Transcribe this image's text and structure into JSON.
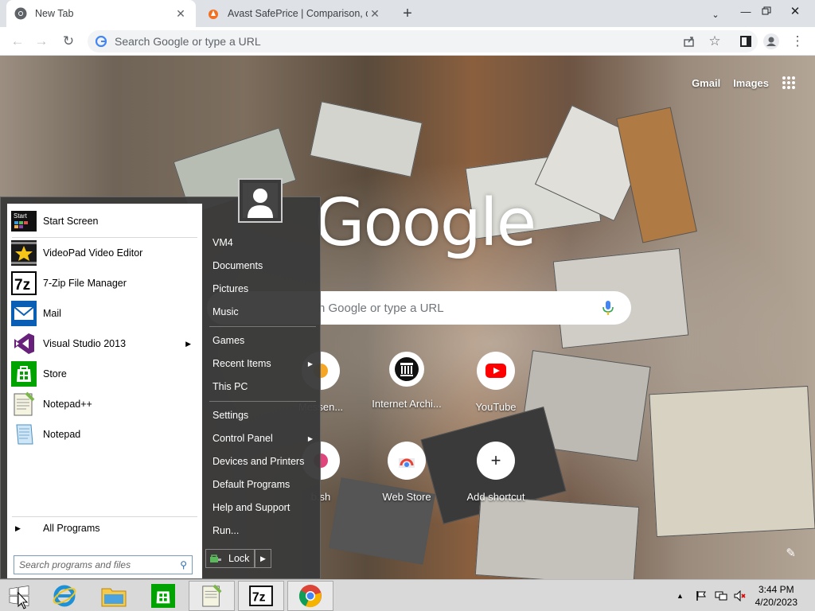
{
  "browser": {
    "tabs": [
      {
        "title": "New Tab",
        "icon": "chrome-icon",
        "active": true
      },
      {
        "title": "Avast SafePrice | Comparison, de",
        "icon": "avast-icon",
        "active": false
      }
    ],
    "new_tab_symbol": "+",
    "omnibox_placeholder": "Search Google or type a URL"
  },
  "ntp": {
    "links": [
      "Gmail",
      "Images"
    ],
    "logo": "Google",
    "search_placeholder": "Search Google or type a URL",
    "search_visible": "h Google or type a URL",
    "shortcuts": [
      {
        "label": "Messen...",
        "icon": "messenger-icon"
      },
      {
        "label": "Internet Archi...",
        "icon": "archive-icon"
      },
      {
        "label": "YouTube",
        "icon": "youtube-icon"
      },
      {
        "label": "b.sh",
        "icon": "site-icon"
      },
      {
        "label": "Web Store",
        "icon": "webstore-icon"
      },
      {
        "label": "Add shortcut",
        "icon": "plus-icon"
      }
    ]
  },
  "start_menu": {
    "programs": [
      {
        "label": "Start Screen",
        "icon": "start-screen-icon",
        "submenu": false
      },
      {
        "label": "VideoPad Video Editor",
        "icon": "videopad-icon",
        "submenu": false
      },
      {
        "label": "7-Zip File Manager",
        "icon": "7zip-icon",
        "submenu": false
      },
      {
        "label": "Mail",
        "icon": "mail-icon",
        "submenu": false
      },
      {
        "label": "Visual Studio 2013",
        "icon": "visual-studio-icon",
        "submenu": true
      },
      {
        "label": "Store",
        "icon": "store-icon",
        "submenu": false
      },
      {
        "label": "Notepad++",
        "icon": "notepadpp-icon",
        "submenu": false
      },
      {
        "label": "Notepad",
        "icon": "notepad-icon",
        "submenu": false
      }
    ],
    "start_icon_text": "Start",
    "all_programs": "All Programs",
    "search_placeholder": "Search programs and files",
    "right_items": [
      {
        "label": "VM4",
        "submenu": false
      },
      {
        "label": "Documents",
        "submenu": false
      },
      {
        "label": "Pictures",
        "submenu": false
      },
      {
        "label": "Music",
        "submenu": false
      },
      {
        "label": "Games",
        "submenu": false
      },
      {
        "label": "Recent Items",
        "submenu": true
      },
      {
        "label": "This PC",
        "submenu": false
      },
      {
        "label": "Settings",
        "submenu": false
      },
      {
        "label": "Control Panel",
        "submenu": true
      },
      {
        "label": "Devices and Printers",
        "submenu": false
      },
      {
        "label": "Default Programs",
        "submenu": false
      },
      {
        "label": "Help and Support",
        "submenu": false
      },
      {
        "label": "Run...",
        "submenu": false
      }
    ],
    "lock_label": "Lock"
  },
  "taskbar": {
    "apps": [
      "internet-explorer-icon",
      "file-explorer-icon",
      "store-icon",
      "notepadpp-icon",
      "7zip-icon",
      "chrome-icon"
    ],
    "seven_zip_text": "7z",
    "time": "3:44 PM",
    "date": "4/20/2023"
  }
}
